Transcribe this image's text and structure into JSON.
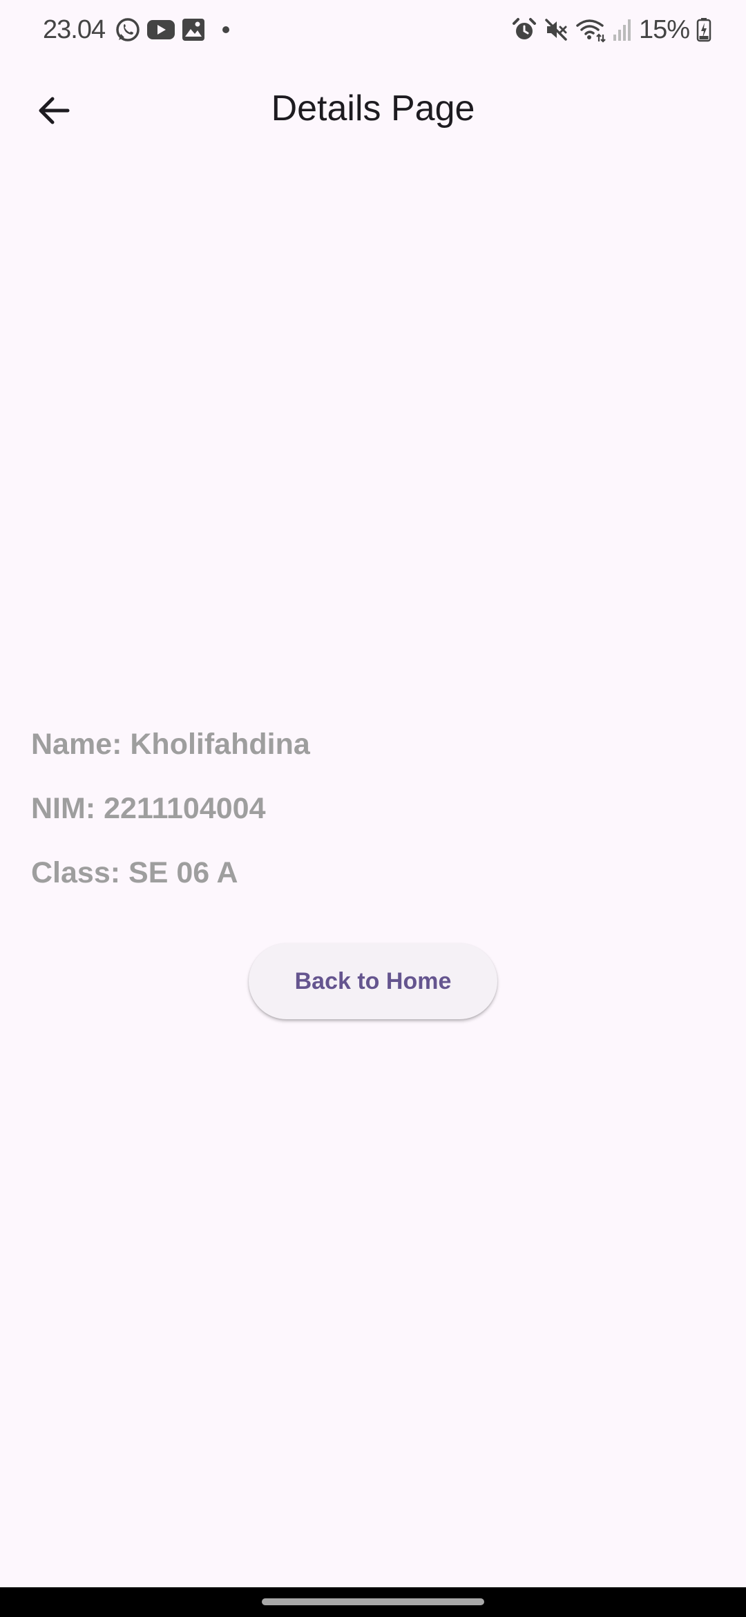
{
  "status_bar": {
    "time": "23.04",
    "notification_icons": [
      "whatsapp-icon",
      "youtube-icon",
      "gallery-icon",
      "dot-icon"
    ],
    "system_icons": [
      "alarm-icon",
      "mute-icon",
      "wifi-icon",
      "signal-icon"
    ],
    "battery_percent": "15%"
  },
  "app_bar": {
    "title": "Details Page",
    "back_icon": "arrow-back-icon"
  },
  "details": {
    "name": "Name: Kholifahdina",
    "nim": "NIM: 2211104004",
    "class": "Class: SE 06 A"
  },
  "actions": {
    "back_home_label": "Back to Home"
  },
  "colors": {
    "background": "#fdf7fd",
    "info_text": "#9e9e9e",
    "button_text": "#65558f",
    "button_bg": "#f5f1f6"
  }
}
